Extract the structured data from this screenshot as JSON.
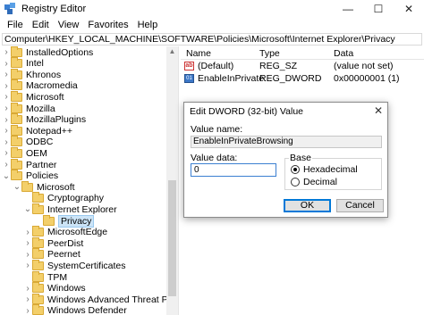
{
  "window": {
    "title": "Registry Editor",
    "controls": {
      "minimize": "—",
      "maximize": "☐",
      "close": "✕"
    }
  },
  "menu": [
    "File",
    "Edit",
    "View",
    "Favorites",
    "Help"
  ],
  "address": "Computer\\HKEY_LOCAL_MACHINE\\SOFTWARE\\Policies\\Microsoft\\Internet Explorer\\Privacy",
  "tree": [
    {
      "label": "InstalledOptions",
      "chevron": "›"
    },
    {
      "label": "Intel",
      "chevron": "›"
    },
    {
      "label": "Khronos",
      "chevron": "›"
    },
    {
      "label": "Macromedia",
      "chevron": "›"
    },
    {
      "label": "Microsoft",
      "chevron": "›"
    },
    {
      "label": "Mozilla",
      "chevron": "›"
    },
    {
      "label": "MozillaPlugins",
      "chevron": "›"
    },
    {
      "label": "Notepad++",
      "chevron": "›"
    },
    {
      "label": "ODBC",
      "chevron": "›"
    },
    {
      "label": "OEM",
      "chevron": "›"
    },
    {
      "label": "Partner",
      "chevron": "›"
    },
    {
      "label": "Policies",
      "chevron": "⌄"
    },
    {
      "label": "Microsoft",
      "chevron": "⌄"
    },
    {
      "label": "Cryptography",
      "chevron": ""
    },
    {
      "label": "Internet Explorer",
      "chevron": "⌄"
    },
    {
      "label": "Privacy",
      "chevron": ""
    },
    {
      "label": "MicrosoftEdge",
      "chevron": "›"
    },
    {
      "label": "PeerDist",
      "chevron": "›"
    },
    {
      "label": "Peernet",
      "chevron": "›"
    },
    {
      "label": "SystemCertificates",
      "chevron": "›"
    },
    {
      "label": "TPM",
      "chevron": ""
    },
    {
      "label": "Windows",
      "chevron": "›"
    },
    {
      "label": "Windows Advanced Threat Protection",
      "chevron": "›"
    },
    {
      "label": "Windows Defender",
      "chevron": "›"
    }
  ],
  "values_header": {
    "name": "Name",
    "type": "Type",
    "data": "Data"
  },
  "values": [
    {
      "icon": "ab",
      "name": "(Default)",
      "type": "REG_SZ",
      "data": "(value not set)"
    },
    {
      "icon": "dword",
      "name": "EnableInPrivate...",
      "type": "REG_DWORD",
      "data": "0x00000001 (1)"
    }
  ],
  "dialog": {
    "title": "Edit DWORD (32-bit) Value",
    "close": "✕",
    "value_name_label": "Value name:",
    "value_name": "EnableInPrivateBrowsing",
    "value_data_label": "Value data:",
    "value_data": "0",
    "base_label": "Base",
    "hex_label": "Hexadecimal",
    "dec_label": "Decimal",
    "selected_base": "Hexadecimal",
    "ok": "OK",
    "cancel": "Cancel"
  }
}
